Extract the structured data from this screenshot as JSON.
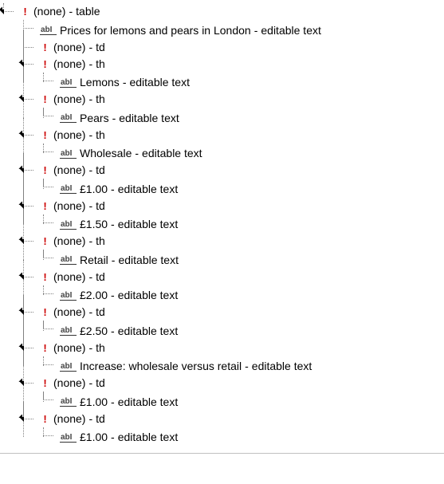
{
  "roles": {
    "table": "table",
    "td": "td",
    "th": "th",
    "editable": "editable text"
  },
  "none_label": "(none)",
  "tree": {
    "name": "(none)",
    "role": "table",
    "children": [
      {
        "text": "Prices for lemons and pears in London",
        "role": "editable text"
      },
      {
        "name": "(none)",
        "role": "td"
      },
      {
        "name": "(none)",
        "role": "th",
        "children": [
          {
            "text": "Lemons",
            "role": "editable text"
          }
        ]
      },
      {
        "name": "(none)",
        "role": "th",
        "children": [
          {
            "text": "Pears",
            "role": "editable text"
          }
        ]
      },
      {
        "name": "(none)",
        "role": "th",
        "children": [
          {
            "text": "Wholesale",
            "role": "editable text"
          }
        ]
      },
      {
        "name": "(none)",
        "role": "td",
        "children": [
          {
            "text": "£1.00",
            "role": "editable text"
          }
        ]
      },
      {
        "name": "(none)",
        "role": "td",
        "children": [
          {
            "text": "£1.50",
            "role": "editable text"
          }
        ]
      },
      {
        "name": "(none)",
        "role": "th",
        "children": [
          {
            "text": "Retail",
            "role": "editable text"
          }
        ]
      },
      {
        "name": "(none)",
        "role": "td",
        "children": [
          {
            "text": "£2.00",
            "role": "editable text"
          }
        ]
      },
      {
        "name": "(none)",
        "role": "td",
        "children": [
          {
            "text": "£2.50",
            "role": "editable text"
          }
        ]
      },
      {
        "name": "(none)",
        "role": "th",
        "children": [
          {
            "text": "Increase: wholesale versus retail",
            "role": "editable text"
          }
        ]
      },
      {
        "name": "(none)",
        "role": "td",
        "children": [
          {
            "text": "£1.00",
            "role": "editable text"
          }
        ]
      },
      {
        "name": "(none)",
        "role": "td",
        "children": [
          {
            "text": "£1.00",
            "role": "editable text"
          }
        ]
      }
    ]
  }
}
